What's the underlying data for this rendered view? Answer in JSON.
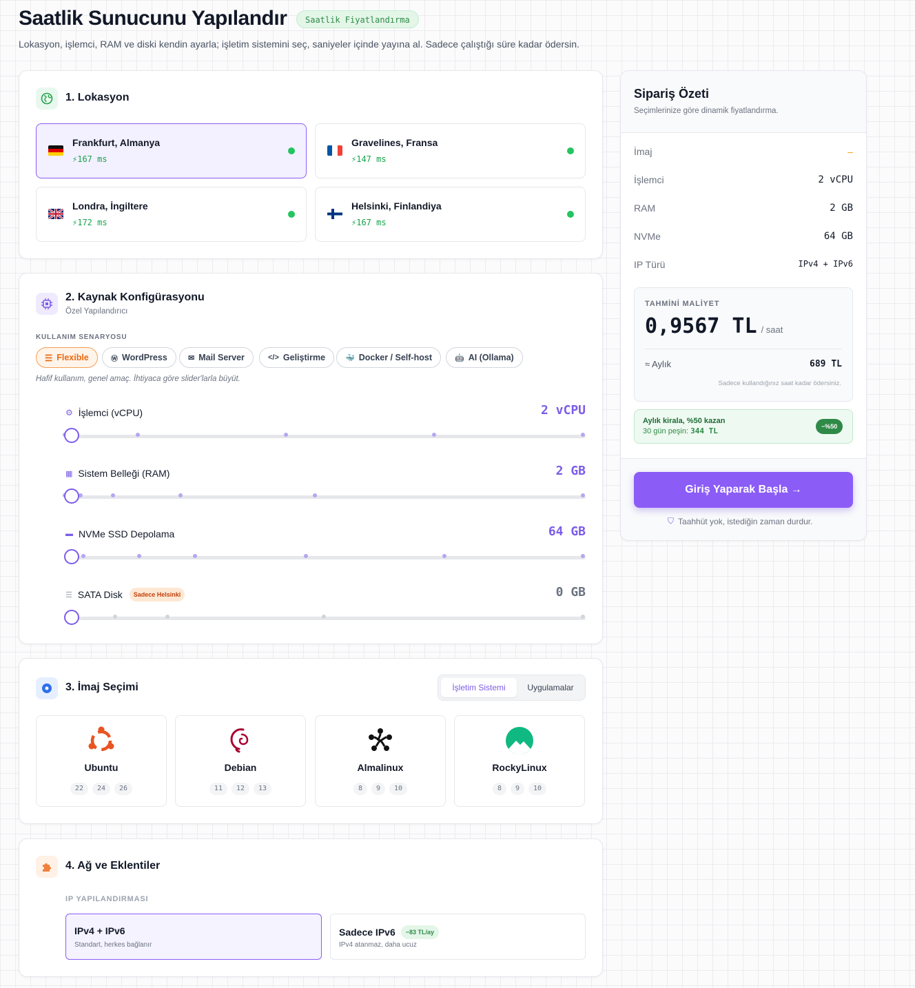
{
  "header": {
    "title": "Saatlik Sunucunu Yapılandır",
    "badge": "Saatlik Fiyatlandırma",
    "subtitle": "Lokasyon, işlemci, RAM ve diski kendin ayarla; işletim sistemini seç, saniyeler içinde yayına al. Sadece çalıştığı süre kadar ödersin."
  },
  "location": {
    "title": "1. Lokasyon",
    "items": [
      {
        "name": "Frankfurt, Almanya",
        "ping": "167 ms",
        "flag": "de",
        "selected": true
      },
      {
        "name": "Gravelines, Fransa",
        "ping": "147 ms",
        "flag": "fr",
        "selected": false
      },
      {
        "name": "Londra, İngiltere",
        "ping": "172 ms",
        "flag": "gb",
        "selected": false
      },
      {
        "name": "Helsinki, Finlandiya",
        "ping": "167 ms",
        "flag": "fi",
        "selected": false
      }
    ]
  },
  "resources": {
    "title": "2. Kaynak Konfigürasyonu",
    "subtitle": "Özel Yapılandırıcı",
    "usage_label": "KULLANIM SENARYOSU",
    "scenarios": [
      "Flexible",
      "WordPress",
      "Mail Server",
      "Geliştirme",
      "Docker / Self-host",
      "AI (Ollama)"
    ],
    "hint": "Hafif kullanım, genel amaç. İhtiyaca göre slider'larla büyüt.",
    "sliders": [
      {
        "label": "İşlemci (vCPU)",
        "value": "2 vCPU",
        "icon": "cpu-icon",
        "level": 0
      },
      {
        "label": "Sistem Belleği (RAM)",
        "value": "2 GB",
        "icon": "memory-icon",
        "level": 0
      },
      {
        "label": "NVMe SSD Depolama",
        "value": "64 GB",
        "icon": "nvme-icon",
        "level": 0
      },
      {
        "label": "SATA Disk",
        "value": "0 GB",
        "icon": "sata-icon",
        "tag": "Sadece Helsinki",
        "level": 0
      }
    ]
  },
  "images": {
    "title": "3. İmaj Seçimi",
    "tabs": [
      "İşletim Sistemi",
      "Uygulamalar"
    ],
    "items": [
      {
        "name": "Ubuntu",
        "versions": [
          "22",
          "24",
          "26"
        ]
      },
      {
        "name": "Debian",
        "versions": [
          "11",
          "12",
          "13"
        ]
      },
      {
        "name": "Almalinux",
        "versions": [
          "8",
          "9",
          "10"
        ]
      },
      {
        "name": "RockyLinux",
        "versions": [
          "8",
          "9",
          "10"
        ]
      }
    ]
  },
  "network": {
    "title": "4. Ağ ve Eklentiler",
    "ip_label": "IP YAPILANDIRMASI",
    "options": [
      {
        "title": "IPv4 + IPv6",
        "desc": "Standart, herkes bağlanır",
        "selected": true
      },
      {
        "title": "Sadece IPv6",
        "desc": "IPv4 atanmaz, daha ucuz",
        "badge": "−83 TL/ay",
        "selected": false
      }
    ]
  },
  "summary": {
    "title": "Sipariş Özeti",
    "subtitle": "Seçimlerinize göre dinamik fiyatlandırma.",
    "rows": [
      {
        "key": "İmaj",
        "value": "–"
      },
      {
        "key": "İşlemci",
        "value": "2 vCPU"
      },
      {
        "key": "RAM",
        "value": "2 GB"
      },
      {
        "key": "NVMe",
        "value": "64 GB"
      },
      {
        "key": "IP Türü",
        "value": "IPv4 + IPv6"
      }
    ],
    "estimate_label": "TAHMİNİ MALİYET",
    "hourly_price": "0,9567 TL",
    "hourly_unit": "/ saat",
    "monthly_label": "≈ Aylık",
    "monthly_price": "689 TL",
    "note": "Sadece kullandığınız saat kadar ödersiniz.",
    "promo_title": "Aylık kirala, %50 kazan",
    "promo_text_prefix": "30 gün peşin:",
    "promo_price": "344 TL",
    "promo_badge": "−%50",
    "cta": "Giriş Yaparak Başla →",
    "footnote": "Taahhüt yok, istediğin zaman durdur."
  },
  "colors": {
    "accent": "#7c5ce8",
    "success": "#22c55e",
    "orange": "#ea6a12"
  }
}
